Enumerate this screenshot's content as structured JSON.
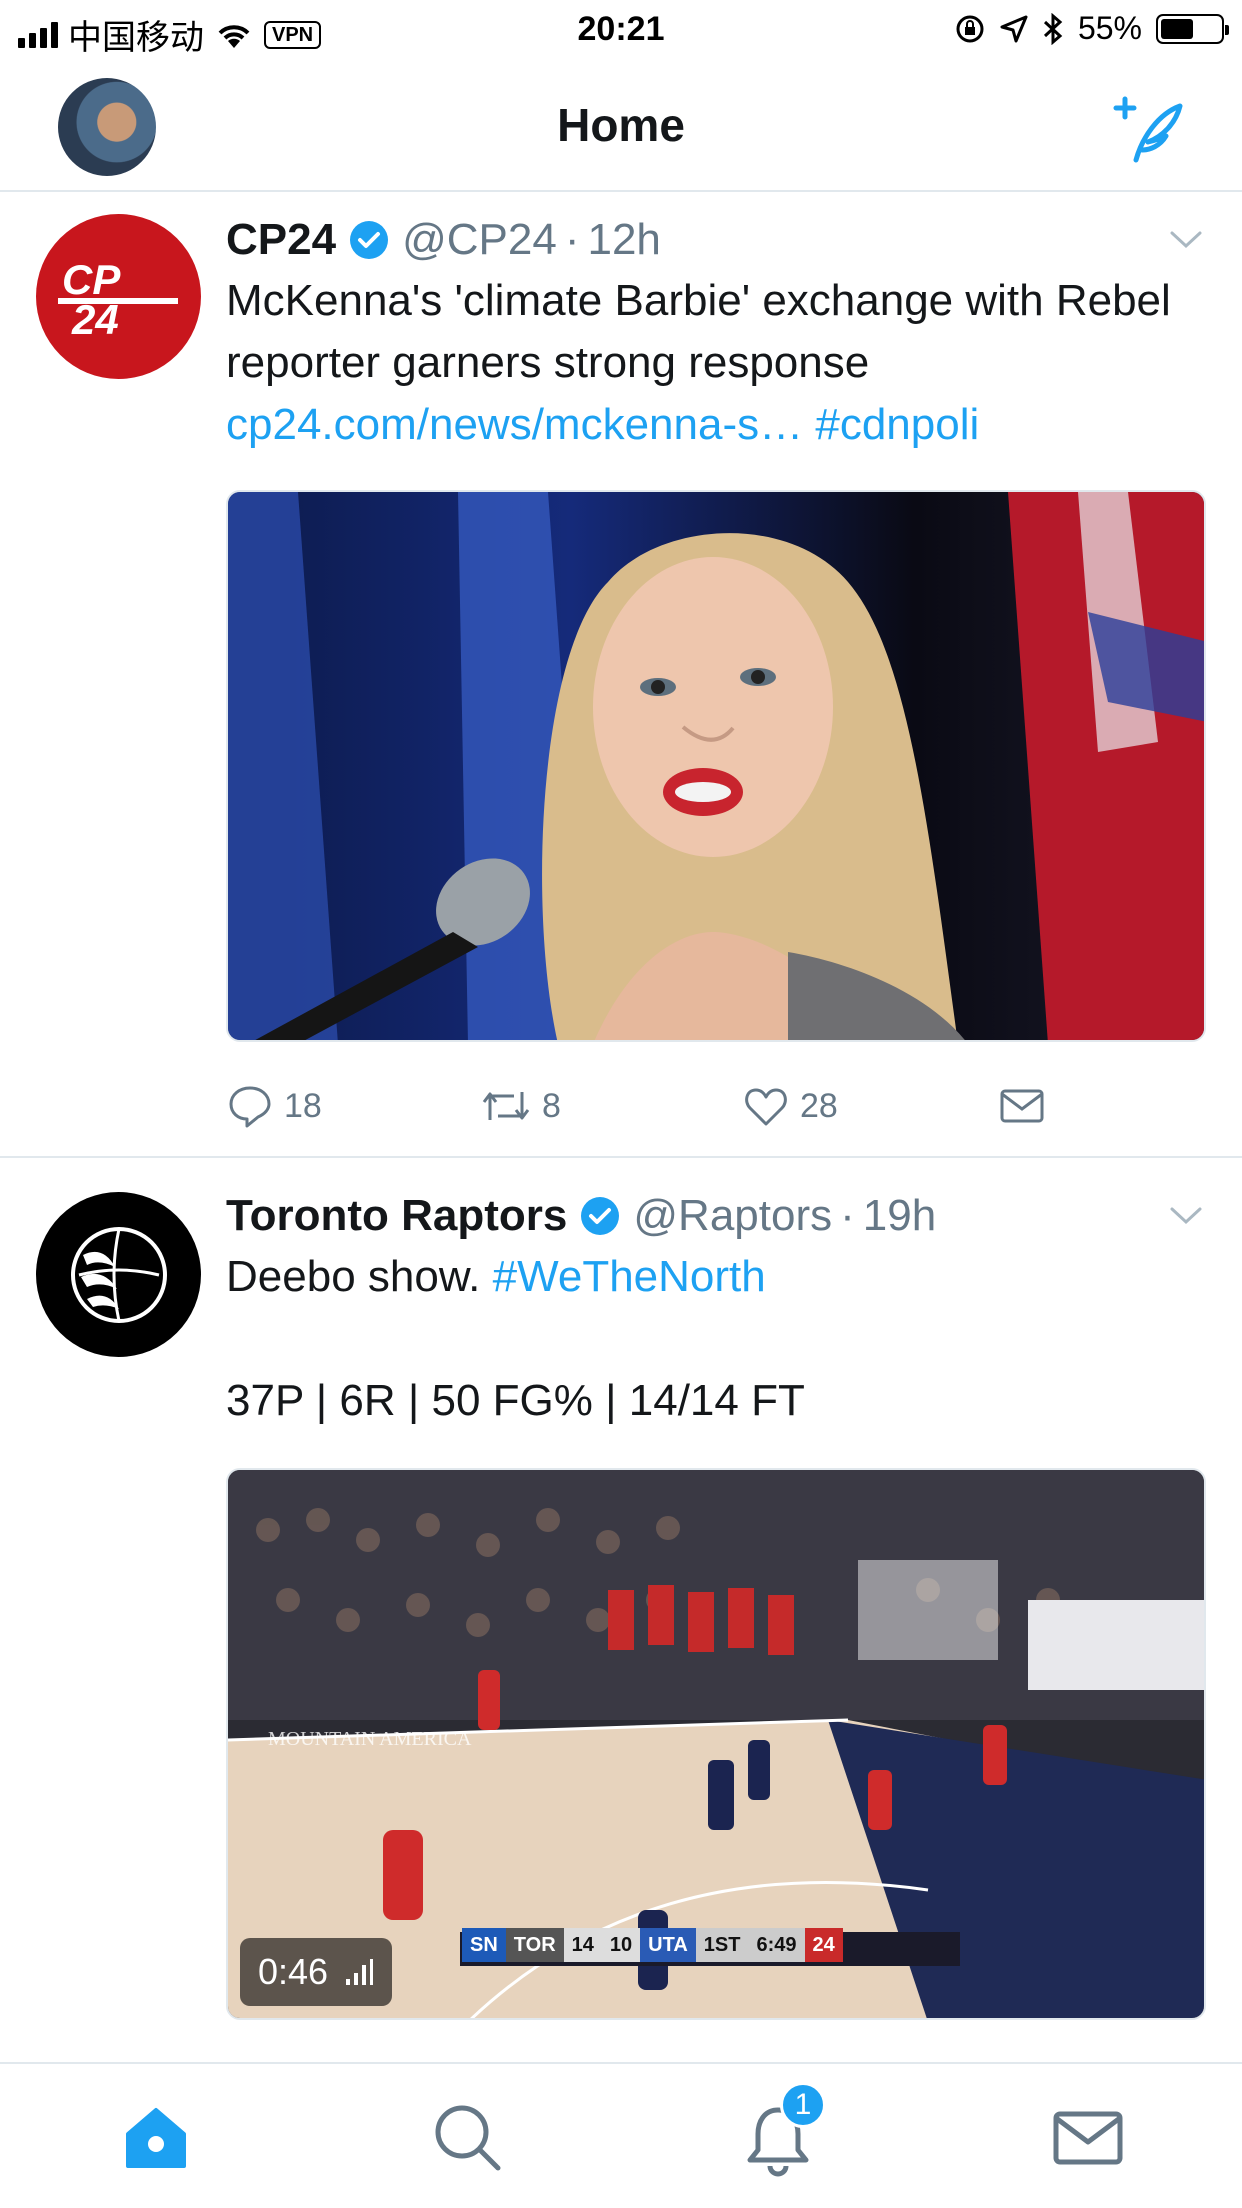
{
  "status_bar": {
    "carrier": "中国移动",
    "vpn": "VPN",
    "time": "20:21",
    "battery": "55%",
    "battery_level": 0.55
  },
  "header": {
    "title": "Home"
  },
  "tweets": [
    {
      "name": "CP24",
      "verified": true,
      "handle": "@CP24",
      "time": "12h",
      "text": "McKenna's 'climate Barbie' exchange with Rebel reporter garners strong response",
      "link": "cp24.com/news/mckenna-s…",
      "hashtag": "#cdnpoli",
      "avatar_text": "CP24",
      "counts": {
        "replies": "18",
        "retweets": "8",
        "likes": "28"
      }
    },
    {
      "name": "Toronto Raptors",
      "verified": true,
      "handle": "@Raptors",
      "time": "19h",
      "text": "Deebo show.",
      "hashtag": "#WeTheNorth",
      "stats": "37P | 6R | 50 FG% | 14/14 FT",
      "video": {
        "duration": "0:46",
        "scorebug": {
          "net": "SN",
          "team1": "TOR",
          "score1": "14",
          "score2": "10",
          "team2": "UTA",
          "period": "1ST",
          "clock": "6:49",
          "shot": "24"
        }
      }
    }
  ],
  "tabbar": {
    "notifications_badge": "1"
  },
  "colors": {
    "accent": "#1da1f2",
    "cp24_red": "#c8161d",
    "text": "#14171a",
    "muted": "#657786",
    "divider": "#e1e8ed"
  }
}
